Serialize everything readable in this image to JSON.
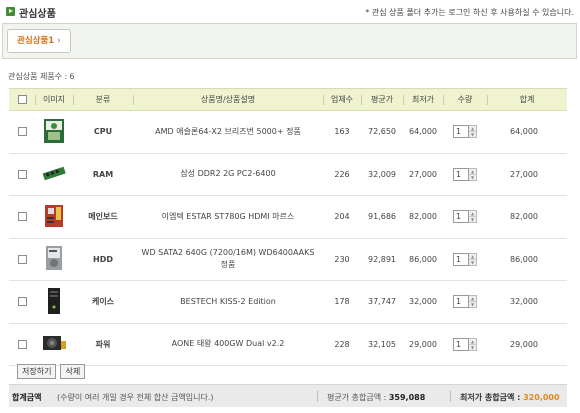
{
  "header": {
    "title": "관심상품",
    "notice": "* 관심 상품 폴더 추가는 로그인 하신 후 사용하실 수 있습니다."
  },
  "tab": {
    "label": "관심상품1",
    "chevron": "›"
  },
  "count": {
    "label": "관심상품 제품수 :",
    "value": "6"
  },
  "columns": {
    "image": "이미지",
    "category": "분류",
    "name": "상품명/상품설명",
    "vendors": "업체수",
    "avg_price": "평균가",
    "low_price": "최저가",
    "qty": "수량",
    "total": "합계"
  },
  "rows": [
    {
      "category": "CPU",
      "icon": "cpu-box-image",
      "name": "AMD 애슬론64-X2 브리즈번 5000+ 정품",
      "vendors": "163",
      "avg": "72,650",
      "low": "64,000",
      "qty": "1",
      "total": "64,000"
    },
    {
      "category": "RAM",
      "icon": "ram-stick-image",
      "name": "삼성 DDR2 2G PC2-6400",
      "vendors": "226",
      "avg": "32,009",
      "low": "27,000",
      "qty": "1",
      "total": "27,000"
    },
    {
      "category": "메인보드",
      "icon": "motherboard-image",
      "name": "이엠텍 ESTAR ST780G HDMI 마르스",
      "vendors": "204",
      "avg": "91,686",
      "low": "82,000",
      "qty": "1",
      "total": "82,000"
    },
    {
      "category": "HDD",
      "icon": "hdd-image",
      "name": "WD SATA2 640G (7200/16M) WD6400AAKS 정품",
      "vendors": "230",
      "avg": "92,891",
      "low": "86,000",
      "qty": "1",
      "total": "86,000"
    },
    {
      "category": "케이스",
      "icon": "pc-case-image",
      "name": "BESTECH KISS-2 Edition",
      "vendors": "178",
      "avg": "37,747",
      "low": "32,000",
      "qty": "1",
      "total": "32,000"
    },
    {
      "category": "파워",
      "icon": "power-supply-image",
      "name": "AONE 태왕 400GW Dual v2.2",
      "vendors": "228",
      "avg": "32,105",
      "low": "29,000",
      "qty": "1",
      "total": "29,000"
    }
  ],
  "actions": {
    "save": "저장하기",
    "delete": "삭제"
  },
  "footer": {
    "label": "합계금액",
    "note": "(수량이 여러 개일 경우 전체 합산 금액입니다.)",
    "avg_label": "평균가 총합금액 :",
    "avg_value": "359,088",
    "low_label": "최저가 총합금액 :",
    "low_value": "320,000"
  },
  "colors": {
    "accent": "#3f8f32",
    "low_price": "#e0891c",
    "header_bg": "#eff3d0"
  }
}
